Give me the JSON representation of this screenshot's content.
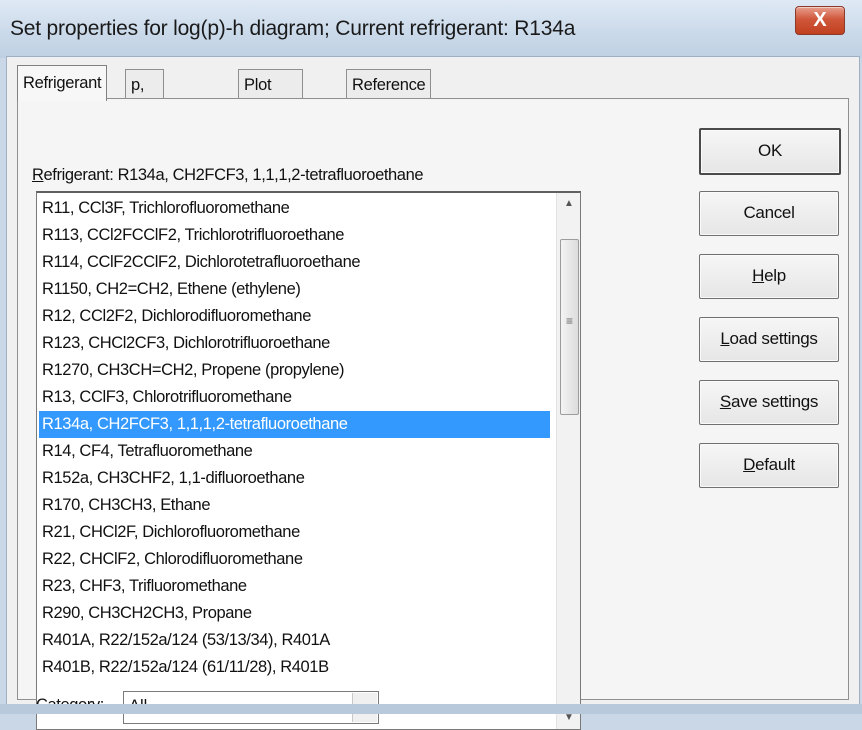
{
  "window": {
    "title": "Set properties for log(p)-h diagram; Current refrigerant: R134a",
    "close_label": "X"
  },
  "tabs": [
    {
      "label": "Refrigerant",
      "active": true
    },
    {
      "label": "p, T, s and h",
      "active": false
    },
    {
      "label": "Plot specific",
      "active": false
    },
    {
      "label": "Reference",
      "active": false
    }
  ],
  "refrigerant": {
    "label_accel": "R",
    "label_rest": "efrigerant:",
    "current_value": "R134a, CH2FCF3, 1,1,1,2-tetrafluoroethane"
  },
  "refrigerant_list": {
    "items": [
      "R11, CCl3F, Trichlorofluoromethane",
      "R113, CCl2FCClF2, Trichlorotrifluoroethane",
      "R114, CClF2CClF2, Dichlorotetrafluoroethane",
      "R1150, CH2=CH2, Ethene (ethylene)",
      "R12, CCl2F2, Dichlorodifluoromethane",
      "R123, CHCl2CF3, Dichlorotrifluoroethane",
      "R1270, CH3CH=CH2, Propene (propylene)",
      "R13, CClF3, Chlorotrifluoromethane",
      "R134a, CH2FCF3, 1,1,1,2-tetrafluoroethane",
      "R14, CF4, Tetrafluoromethane",
      "R152a, CH3CHF2, 1,1-difluoroethane",
      "R170, CH3CH3, Ethane",
      "R21, CHCl2F, Dichlorofluoromethane",
      "R22, CHClF2, Chlorodifluoromethane",
      "R23, CHF3, Trifluoromethane",
      "R290, CH3CH2CH3, Propane",
      "R401A, R22/152a/124 (53/13/34), R401A",
      "R401B, R22/152a/124 (61/11/28), R401B"
    ],
    "selected_index": 8,
    "scroll_up_glyph": "▲",
    "scroll_down_glyph": "▼",
    "grip_glyph": "≡"
  },
  "category": {
    "label_accel": "C",
    "label_rest": "ategory:",
    "value": "All",
    "dropdown_glyph": "▼"
  },
  "buttons": {
    "ok": {
      "label": "OK"
    },
    "cancel": {
      "label": "Cancel"
    },
    "help": {
      "accel": "H",
      "rest": "elp"
    },
    "load": {
      "accel": "L",
      "rest": "oad settings"
    },
    "save": {
      "accel": "S",
      "rest": "ave settings"
    },
    "default": {
      "accel": "D",
      "rest": "efault"
    }
  }
}
